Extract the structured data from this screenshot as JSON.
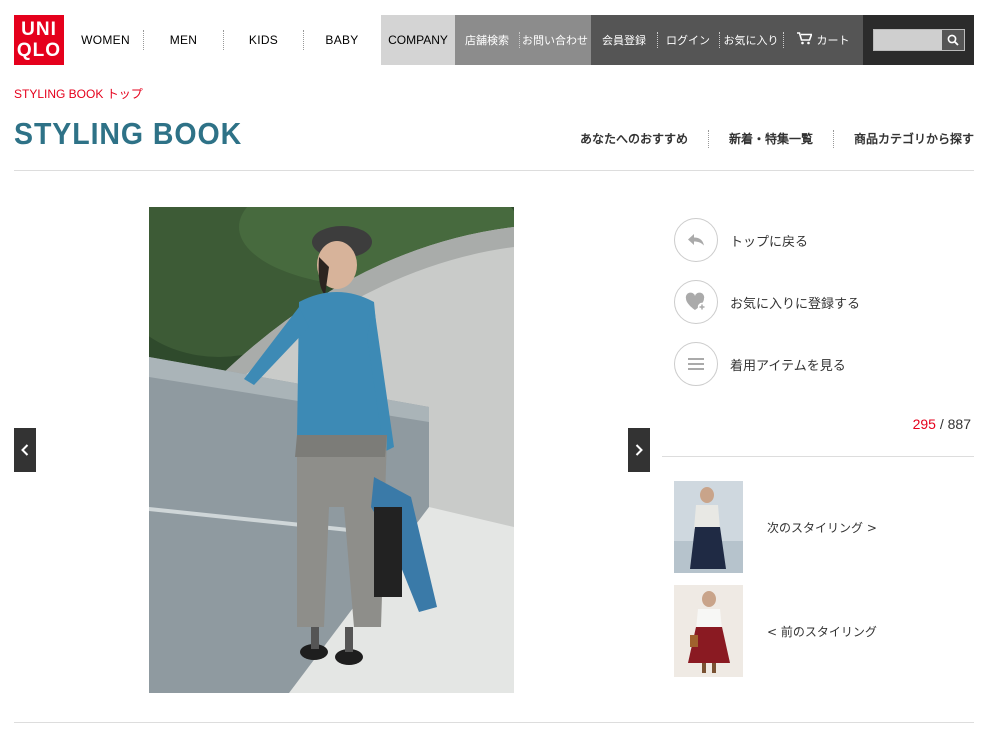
{
  "brand": {
    "line1": "UNI",
    "line2": "QLO"
  },
  "header": {
    "gender_nav": [
      "WOMEN",
      "MEN",
      "KIDS",
      "BABY"
    ],
    "company": "COMPANY",
    "store_search": "店舗検索",
    "contact": "お問い合わせ",
    "member_register": "会員登録",
    "login": "ログイン",
    "favorites": "お気に入り",
    "cart": "カート",
    "search": {
      "placeholder": ""
    }
  },
  "breadcrumb": "STYLING BOOK トップ",
  "page_title": "STYLING BOOK",
  "subnav": [
    "あなたへのおすすめ",
    "新着・特集一覧",
    "商品カテゴリから探す"
  ],
  "actions": {
    "back_top": "トップに戻る",
    "add_favorite": "お気に入りに登録する",
    "view_items": "着用アイテムを見る"
  },
  "counter": {
    "current": "295",
    "separator": " / ",
    "total": "887"
  },
  "styling_nav": {
    "next": "次のスタイリング >",
    "prev": "< 前のスタイリング"
  },
  "colors": {
    "brand_red": "#e5001c",
    "title_teal": "#2e7287"
  }
}
